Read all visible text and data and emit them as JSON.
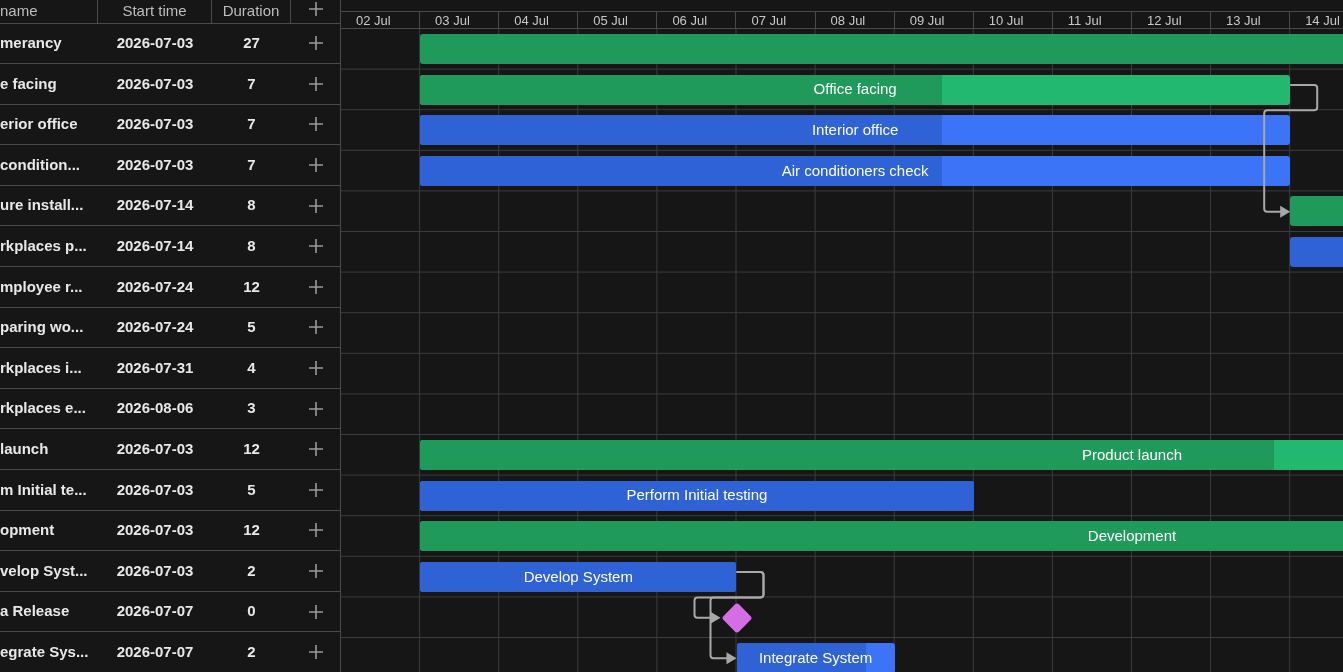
{
  "grid": {
    "columns": [
      "name",
      "Start time",
      "Duration"
    ],
    "rows": [
      {
        "name": "merancy",
        "start": "2026-07-03",
        "duration": "27",
        "kind": "project",
        "has_predecessor": false
      },
      {
        "name": "e facing",
        "start": "2026-07-03",
        "duration": "7",
        "kind": "project",
        "level": 0.6,
        "bar_label": "Office facing",
        "has_predecessor": false
      },
      {
        "name": "erior office",
        "start": "2026-07-03",
        "duration": "7",
        "kind": "task",
        "level": 0.6,
        "bar_label": "Interior office",
        "has_predecessor": false
      },
      {
        "name": "condition...",
        "start": "2026-07-03",
        "duration": "7",
        "kind": "task",
        "level": 0.6,
        "bar_label": "Air conditioners check",
        "has_predecessor": false
      },
      {
        "name": "ure install...",
        "start": "2026-07-14",
        "duration": "8",
        "kind": "project",
        "has_predecessor": true
      },
      {
        "name": "rkplaces p...",
        "start": "2026-07-14",
        "duration": "8",
        "kind": "task",
        "has_predecessor": false
      },
      {
        "name": "mployee r...",
        "start": "2026-07-24",
        "duration": "12",
        "kind": "project",
        "has_predecessor": false
      },
      {
        "name": "paring wo...",
        "start": "2026-07-24",
        "duration": "5",
        "kind": "task",
        "has_predecessor": false
      },
      {
        "name": "rkplaces i...",
        "start": "2026-07-31",
        "duration": "4",
        "kind": "task",
        "has_predecessor": false
      },
      {
        "name": "rkplaces e...",
        "start": "2026-08-06",
        "duration": "3",
        "kind": "task",
        "has_predecessor": false
      },
      {
        "name": "launch",
        "start": "2026-07-03",
        "duration": "12",
        "kind": "project",
        "level": 0.6,
        "bar_label": "Product launch",
        "has_predecessor": false
      },
      {
        "name": "m Initial te...",
        "start": "2026-07-03",
        "duration": "5",
        "kind": "task",
        "level": 1,
        "bar_label": "Perform Initial testing",
        "has_predecessor": false
      },
      {
        "name": "opment",
        "start": "2026-07-03",
        "duration": "12",
        "kind": "project",
        "level": 0.8,
        "bar_label": "Development",
        "has_predecessor": false
      },
      {
        "name": "velop Syst...",
        "start": "2026-07-03",
        "duration": "2",
        "kind": "task",
        "level": 1,
        "bar_label": "Develop System",
        "has_predecessor": false
      },
      {
        "name": "a Release",
        "start": "2026-07-07",
        "duration": "0",
        "kind": "milestone",
        "has_predecessor": true
      },
      {
        "name": "egrate Sys...",
        "start": "2026-07-07",
        "duration": "2",
        "kind": "task",
        "level": 0.82,
        "bar_label": "Integrate System",
        "has_predecessor": true
      }
    ]
  },
  "timeline": {
    "days": [
      "02 Jul",
      "03 Jul",
      "04 Jul",
      "05 Jul",
      "06 Jul",
      "07 Jul",
      "08 Jul",
      "09 Jul",
      "10 Jul",
      "11 Jul",
      "12 Jul",
      "13 Jul",
      "14 Jul"
    ]
  }
}
